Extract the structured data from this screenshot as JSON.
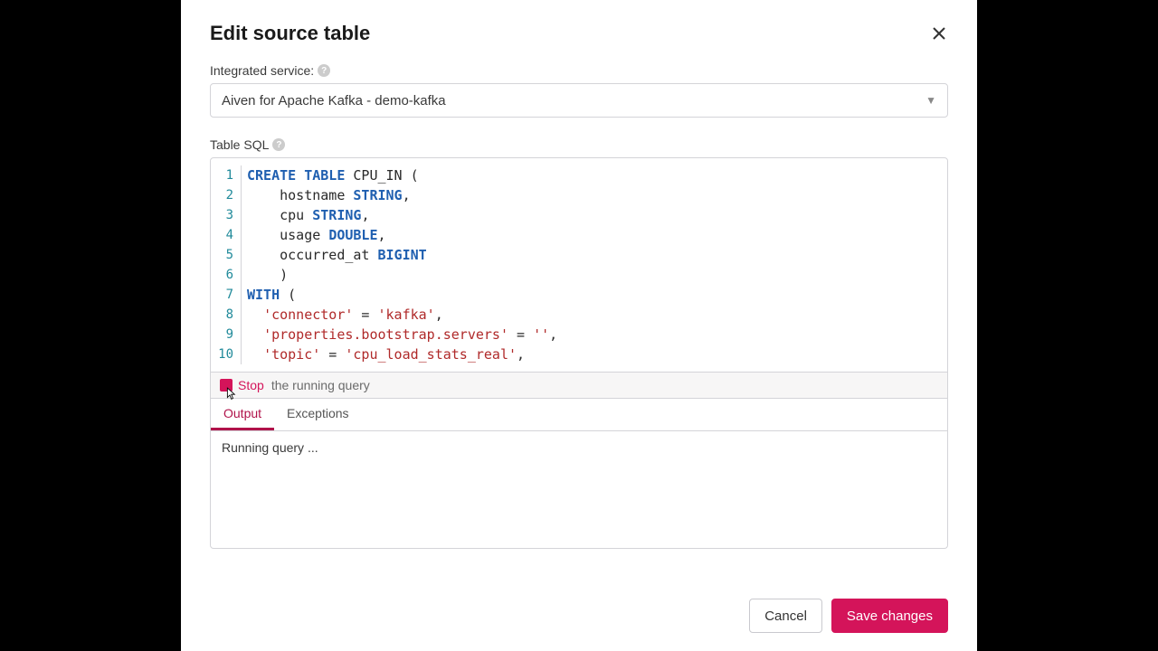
{
  "modal": {
    "title": "Edit source table",
    "close_aria": "Close"
  },
  "service": {
    "label": "Integrated service:",
    "selected": "Aiven for Apache Kafka - demo-kafka"
  },
  "sql": {
    "label": "Table SQL",
    "lines": [
      {
        "n": "1",
        "tokens": [
          [
            "kw",
            "CREATE TABLE"
          ],
          [
            "ident",
            " CPU_IN ("
          ]
        ]
      },
      {
        "n": "2",
        "tokens": [
          [
            "ident",
            "    hostname "
          ],
          [
            "typ",
            "STRING"
          ],
          [
            "ident",
            ","
          ]
        ]
      },
      {
        "n": "3",
        "tokens": [
          [
            "ident",
            "    cpu "
          ],
          [
            "typ",
            "STRING"
          ],
          [
            "ident",
            ","
          ]
        ]
      },
      {
        "n": "4",
        "tokens": [
          [
            "ident",
            "    usage "
          ],
          [
            "typ",
            "DOUBLE"
          ],
          [
            "ident",
            ","
          ]
        ]
      },
      {
        "n": "5",
        "tokens": [
          [
            "ident",
            "    occurred_at "
          ],
          [
            "typ",
            "BIGINT"
          ]
        ]
      },
      {
        "n": "6",
        "tokens": [
          [
            "ident",
            "    )"
          ]
        ]
      },
      {
        "n": "7",
        "tokens": [
          [
            "kw",
            "WITH"
          ],
          [
            "ident",
            " ("
          ]
        ]
      },
      {
        "n": "8",
        "tokens": [
          [
            "ident",
            "  "
          ],
          [
            "str",
            "'connector'"
          ],
          [
            "op",
            " = "
          ],
          [
            "str",
            "'kafka'"
          ],
          [
            "ident",
            ","
          ]
        ]
      },
      {
        "n": "9",
        "tokens": [
          [
            "ident",
            "  "
          ],
          [
            "str",
            "'properties.bootstrap.servers'"
          ],
          [
            "op",
            " = "
          ],
          [
            "str",
            "''"
          ],
          [
            "ident",
            ","
          ]
        ]
      },
      {
        "n": "10",
        "tokens": [
          [
            "ident",
            "  "
          ],
          [
            "str",
            "'topic'"
          ],
          [
            "op",
            " = "
          ],
          [
            "str",
            "'cpu_load_stats_real'"
          ],
          [
            "ident",
            ","
          ]
        ]
      }
    ]
  },
  "run": {
    "stop_label": "Stop",
    "hint": "the running query"
  },
  "tabs": {
    "output": "Output",
    "exceptions": "Exceptions",
    "active": "output"
  },
  "output": {
    "status": "Running query ..."
  },
  "footer": {
    "cancel": "Cancel",
    "save": "Save changes"
  }
}
